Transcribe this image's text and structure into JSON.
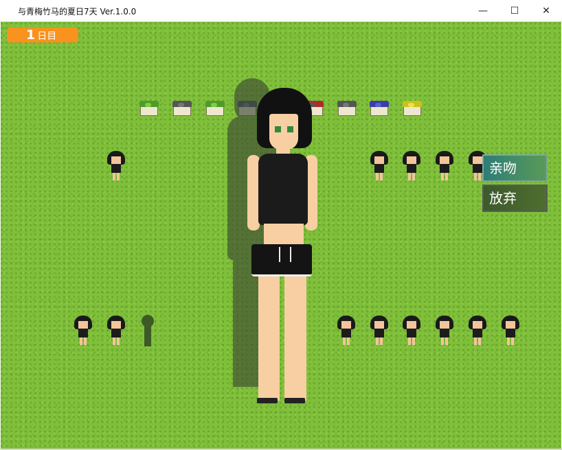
{
  "window": {
    "title": "与青梅竹马的夏日7天 Ver.1.0.0",
    "minimize_glyph": "—",
    "maximize_glyph": "☐",
    "close_glyph": "✕"
  },
  "hud": {
    "day_number": "1",
    "day_label": "日目"
  },
  "choices": {
    "kiss": "亲吻",
    "give_up": "放弃"
  },
  "bentos": [
    {
      "lid_color": "#4f9a2a",
      "dot_color": "#7bd145"
    },
    {
      "lid_color": "#555555",
      "dot_color": "#777777"
    },
    {
      "lid_color": "#4f9a2a",
      "dot_color": "#7bd145"
    },
    {
      "lid_color": "#3d4b70",
      "dot_color": "#5f6e99"
    },
    {
      "lid_color": "#b02a2a",
      "dot_color": "#555555"
    },
    {
      "lid_color": "#555555",
      "dot_color": "#777777"
    },
    {
      "lid_color": "#3b3da8",
      "dot_color": "#5860d8"
    },
    {
      "lid_color": "#c9c21a",
      "dot_color": "#eee04a"
    }
  ]
}
